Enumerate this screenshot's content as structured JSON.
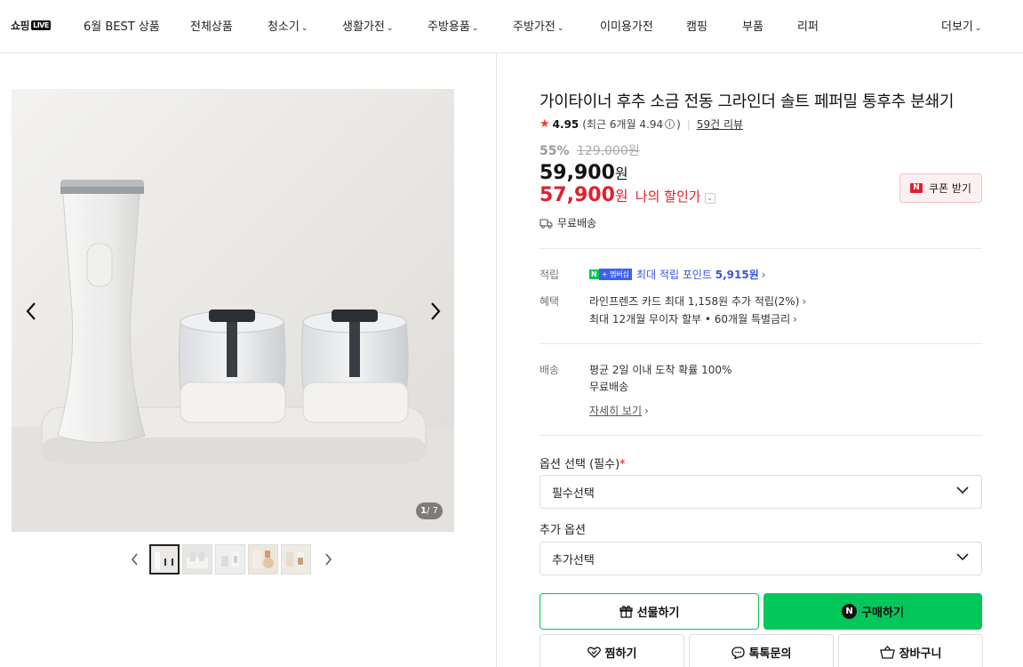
{
  "nav": {
    "logo": "쇼핑",
    "logo_badge": "LIVE",
    "items": [
      {
        "label": "6월 BEST 상품",
        "chevron": false
      },
      {
        "label": "전체상품",
        "chevron": false
      },
      {
        "label": "청소기",
        "chevron": true
      },
      {
        "label": "생활가전",
        "chevron": true
      },
      {
        "label": "주방용품",
        "chevron": true
      },
      {
        "label": "주방가전",
        "chevron": true
      },
      {
        "label": "이미용가전",
        "chevron": false
      },
      {
        "label": "캠핑",
        "chevron": false
      },
      {
        "label": "부품",
        "chevron": false
      },
      {
        "label": "리퍼",
        "chevron": false
      }
    ],
    "more": "더보기"
  },
  "gallery": {
    "counter_current": "1",
    "counter_total": "/ 7",
    "thumbnail_count": 5,
    "active_thumbnail": 1
  },
  "product": {
    "title": "가이타이너 후추 소금 전동 그라인더 솔트 페퍼밀 통후추 분쇄기",
    "rating": "4.95",
    "rating_recent": "(최근 6개월 4.94",
    "rating_recent_close": ")",
    "reviews": "59건 리뷰",
    "discount_rate": "55%",
    "original_price": "129,000원",
    "price": "59,900",
    "my_price": "57,900",
    "currency": "원",
    "my_price_label": "나의 할인가",
    "coupon_label": "쿠폰 받기",
    "coupon_badge": "N",
    "delivery_label": "무료배송"
  },
  "benefits": {
    "points_label": "적립",
    "points_badge_n": "N",
    "points_badge_plus": "+ 멤버십",
    "points_text_prefix": "최대 적립 포인트 ",
    "points_value": "5,915원",
    "benefit_label": "혜택",
    "benefit_line1": "라인프렌즈 카드 최대 1,158원 추가 적립(2%)",
    "benefit_line2": "최대 12개월 무이자 할부 • 60개월 특별금리"
  },
  "shipping": {
    "label": "배송",
    "line1": "평균 2일 이내 도착 확률 100%",
    "line2": "무료배송",
    "detail_link": "자세히 보기"
  },
  "options": {
    "required_label": "옵션 선택 (필수)",
    "required_mark": "*",
    "required_value": "필수선택",
    "extra_label": "추가 옵션",
    "extra_value": "추가선택"
  },
  "actions": {
    "gift": "선물하기",
    "buy": "구매하기",
    "buy_badge": "N",
    "wish": "찜하기",
    "talk": "톡톡문의",
    "cart": "장바구니"
  },
  "colors": {
    "brand_green": "#03c75a",
    "sale_red": "#e0202f",
    "point_blue": "#3a55e0"
  }
}
